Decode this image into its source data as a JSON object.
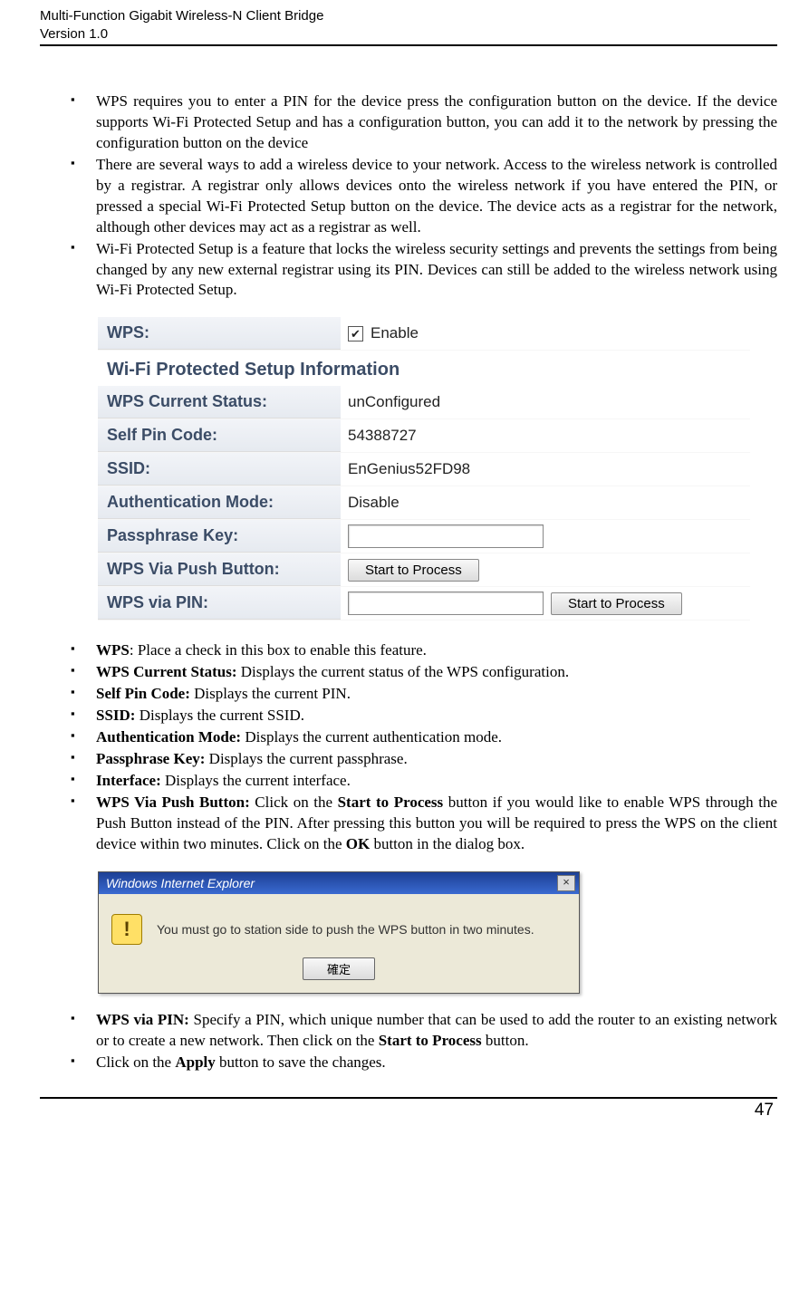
{
  "header": {
    "line1": "Multi-Function Gigabit Wireless-N Client Bridge",
    "line2": "Version 1.0"
  },
  "intro_bullets": [
    "WPS requires you to enter a PIN for the device press the configuration button on the device. If the device supports Wi-Fi Protected Setup and has a configuration button, you can add it to the network by pressing the configuration button on the device",
    "There are several ways to add a wireless device to your network. Access to the wireless network is controlled by a registrar. A registrar only allows devices onto the wireless network if you have entered the PIN, or pressed a special Wi-Fi Protected Setup button on the device. The device acts as a registrar for the network, although other devices may act as a registrar as well.",
    "Wi-Fi Protected Setup is a feature that locks the wireless security settings and prevents the settings from being changed by any new external registrar using its PIN. Devices can still be added to the wireless network using Wi-Fi Protected Setup."
  ],
  "panel": {
    "wps_label": "WPS:",
    "enable_label": "Enable",
    "enable_checked": true,
    "section_title": "Wi-Fi Protected Setup Information",
    "rows": {
      "status_label": "WPS Current Status:",
      "status_value": "unConfigured",
      "pin_label": "Self Pin Code:",
      "pin_value": "54388727",
      "ssid_label": "SSID:",
      "ssid_value": "EnGenius52FD98",
      "auth_label": "Authentication Mode:",
      "auth_value": "Disable",
      "pass_label": "Passphrase Key:",
      "pass_value": "",
      "push_label": "WPS Via Push Button:",
      "push_button": "Start to Process",
      "pin_row_label": "WPS via PIN:",
      "pin_row_value": "",
      "pin_row_button": "Start to Process"
    }
  },
  "def_bullets": [
    {
      "term": "WPS",
      "sep": ": ",
      "desc": "Place a check in this box to enable this feature."
    },
    {
      "term": "WPS Current Status:",
      "sep": " ",
      "desc": "Displays the current status of the WPS configuration."
    },
    {
      "term": "Self Pin Code:",
      "sep": " ",
      "desc": "Displays the current PIN."
    },
    {
      "term": "SSID:",
      "sep": " ",
      "desc": "Displays the current SSID."
    },
    {
      "term": "Authentication Mode:",
      "sep": " ",
      "desc": "Displays the current authentication mode."
    },
    {
      "term": "Passphrase Key:",
      "sep": " ",
      "desc": "Displays the current passphrase."
    },
    {
      "term": "Interface:",
      "sep": " ",
      "desc": "Displays the current interface."
    }
  ],
  "push_bullet": {
    "term": "WPS Via Push Button:",
    "before": " Click on the ",
    "btn1": "Start to Process",
    "mid": " button if you would like to enable WPS through the Push Button instead of the PIN.  After pressing this button you will be required to press the WPS on the client device within two minutes. Click on the ",
    "btn2": "OK",
    "after": " button in the dialog box."
  },
  "dialog": {
    "title": "Windows Internet Explorer",
    "body": "You must go to station side to push the WPS button in two minutes.",
    "button": "確定"
  },
  "tail_bullets": {
    "pin_term": "WPS via PIN:",
    "pin_before": " Specify a PIN, which unique number that can be used to add the router to an existing network or to create a new network. Then click on the ",
    "pin_btn": "Start to Process",
    "pin_after": " button.",
    "apply_before": "Click on the ",
    "apply_btn": "Apply",
    "apply_after": " button to save the changes."
  },
  "page_number": "47"
}
